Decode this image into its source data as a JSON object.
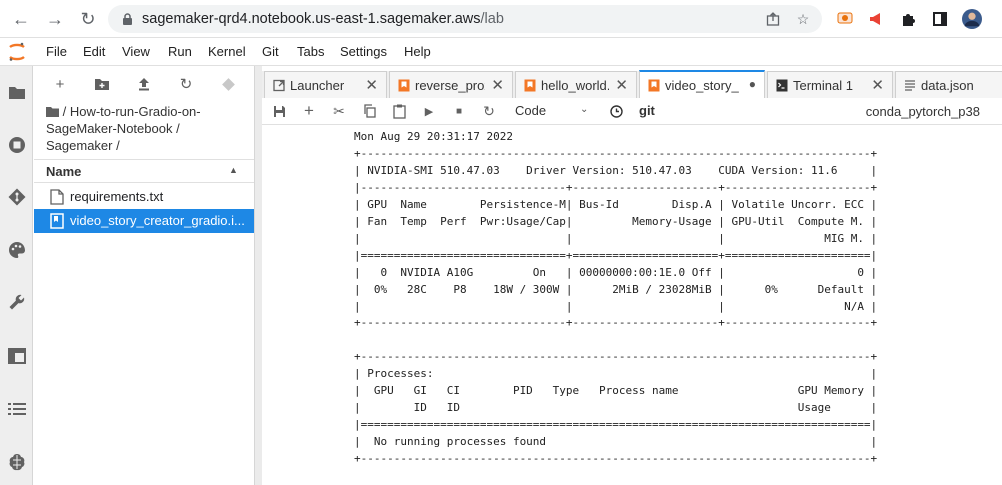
{
  "browser": {
    "back_icon": "arrow-left-icon",
    "forward_icon": "arrow-right-icon",
    "reload_icon": "reload-icon",
    "url_host": "sagemaker-qrd4.notebook.us-east-1.sagemaker.aws",
    "url_path": "/lab"
  },
  "menubar": {
    "items": [
      "File",
      "Edit",
      "View",
      "Run",
      "Kernel",
      "Git",
      "Tabs",
      "Settings",
      "Help"
    ]
  },
  "file_browser": {
    "breadcrumb": "/ How-to-run-Gradio-on-SageMaker-Notebook / Sagemaker /",
    "name_header": "Name",
    "files": [
      {
        "name": "requirements.txt",
        "icon": "text-file-icon",
        "selected": false
      },
      {
        "name": "video_story_creator_gradio.i...",
        "icon": "notebook-icon",
        "selected": true
      }
    ]
  },
  "tabs": [
    {
      "label": "Launcher",
      "icon": "launcher-icon",
      "active": false,
      "close": "✕"
    },
    {
      "label": "reverse_prox",
      "icon": "notebook-icon",
      "active": false,
      "close": "✕"
    },
    {
      "label": "hello_world.i",
      "icon": "notebook-icon",
      "active": false,
      "close": "✕"
    },
    {
      "label": "video_story_",
      "icon": "notebook-icon",
      "active": true,
      "close": "●"
    },
    {
      "label": "Terminal 1",
      "icon": "terminal-icon",
      "active": false,
      "close": "✕"
    },
    {
      "label": "data.json",
      "icon": "json-icon",
      "active": false,
      "close": ""
    }
  ],
  "notebook_toolbar": {
    "cell_type": "Code",
    "git_label": "git",
    "kernel": "conda_pytorch_p38"
  },
  "output": {
    "lines": [
      "Mon Aug 29 20:31:17 2022",
      "+-----------------------------------------------------------------------------+",
      "| NVIDIA-SMI 510.47.03    Driver Version: 510.47.03    CUDA Version: 11.6     |",
      "|-------------------------------+----------------------+----------------------+",
      "| GPU  Name        Persistence-M| Bus-Id        Disp.A | Volatile Uncorr. ECC |",
      "| Fan  Temp  Perf  Pwr:Usage/Cap|         Memory-Usage | GPU-Util  Compute M. |",
      "|                               |                      |               MIG M. |",
      "|===============================+======================+======================|",
      "|   0  NVIDIA A10G         On   | 00000000:00:1E.0 Off |                    0 |",
      "|  0%   28C    P8    18W / 300W |      2MiB / 23028MiB |      0%      Default |",
      "|                               |                      |                  N/A |",
      "+-------------------------------+----------------------+----------------------+",
      "",
      "+-----------------------------------------------------------------------------+",
      "| Processes:                                                                  |",
      "|  GPU   GI   CI        PID   Type   Process name                  GPU Memory |",
      "|        ID   ID                                                   Usage      |",
      "|=============================================================================|",
      "|  No running processes found                                                 |",
      "+-----------------------------------------------------------------------------+"
    ]
  }
}
